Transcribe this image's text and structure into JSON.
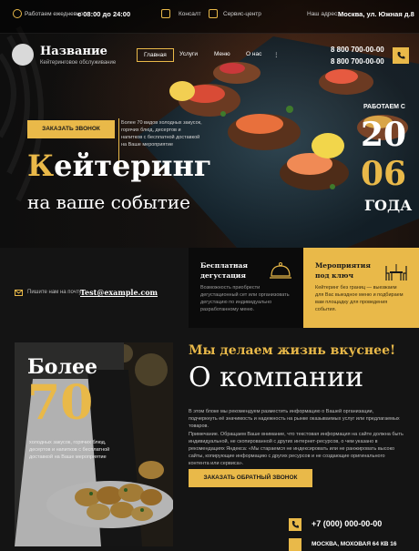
{
  "topbar": {
    "hours_label": "Работаем ежедневно:",
    "hours_value": "с 08:00 до 24:00",
    "link_1": "Консалт",
    "link_2": "Сервис-центр",
    "address_label": "Наш адрес:",
    "address_value": "Москва, ул. Южная д.8"
  },
  "header": {
    "brand": "Название",
    "tagline": "Кейтеринговое обслуживание",
    "nav": [
      "Главная",
      "Услуги",
      "Меню",
      "О нас"
    ],
    "phones": [
      "8 800 700-00-00",
      "8 800 700-00-00"
    ]
  },
  "hero": {
    "cta": "ЗАКАЗАТЬ ЗВОНОК",
    "description": "Более 70 видов холодных закусок, горячих блюд, десертов и напитков с бесплатной доставкой на Ваше мероприятие",
    "title_first_letter": "К",
    "title_rest": "ейтеринг",
    "subtitle": "на ваше событие",
    "years_label": "РАБОТАЕМ С",
    "year_top": "20",
    "year_bottom": "06",
    "years_word": "ГОДА"
  },
  "features": [
    {
      "title": "Бесплатная\nдегустация",
      "text": "Возможность приобрести дегустационный сет или организовать дегустацию по индивидуально разработанному меню."
    },
    {
      "title": "Мероприятия\nпод ключ",
      "text": "Кейтеринг без границ — выезжаем для Вас выездное меню и подбираем вам площадку для проведения события."
    }
  ],
  "mail": {
    "label": "Пишите нам на почту:",
    "value": "Test@example.com"
  },
  "about": {
    "more": "Более",
    "count": "70",
    "photo_text": "холодных закусок, горячих блюд, десертов и напитков с бесплатной доставкой на Ваше мероприятие",
    "tagline": "Мы делаем жизнь вкуснее!",
    "heading": "О компании",
    "paragraph_1": "В этом блоке мы рекомендуем разместить информацию о Вашей организации, подчеркнуть её значимость и надежность на рынке оказываемых услуг или предлагаемых товаров.",
    "paragraph_2": "Примечание. Обращаем Ваше внимание, что текстовая информация на сайте должна быть индивидуальной, не скопированной с других интернет-ресурсов, о чем указано в рекомендациях Яндекса: «Мы стараемся не индексировать или не ранжировать высоко сайты, копирующие информацию с других ресурсов и не создающие оригинального контента или сервиса».",
    "button": "ЗАКАЗАТЬ ОБРАТНЫЙ ЗВОНОК",
    "phone": "+7 (000) 000-00-00",
    "address": "МОСКВА, МОХОВАЯ 64 КВ 16"
  },
  "colors": {
    "accent": "#e9b949",
    "background": "#141414"
  }
}
